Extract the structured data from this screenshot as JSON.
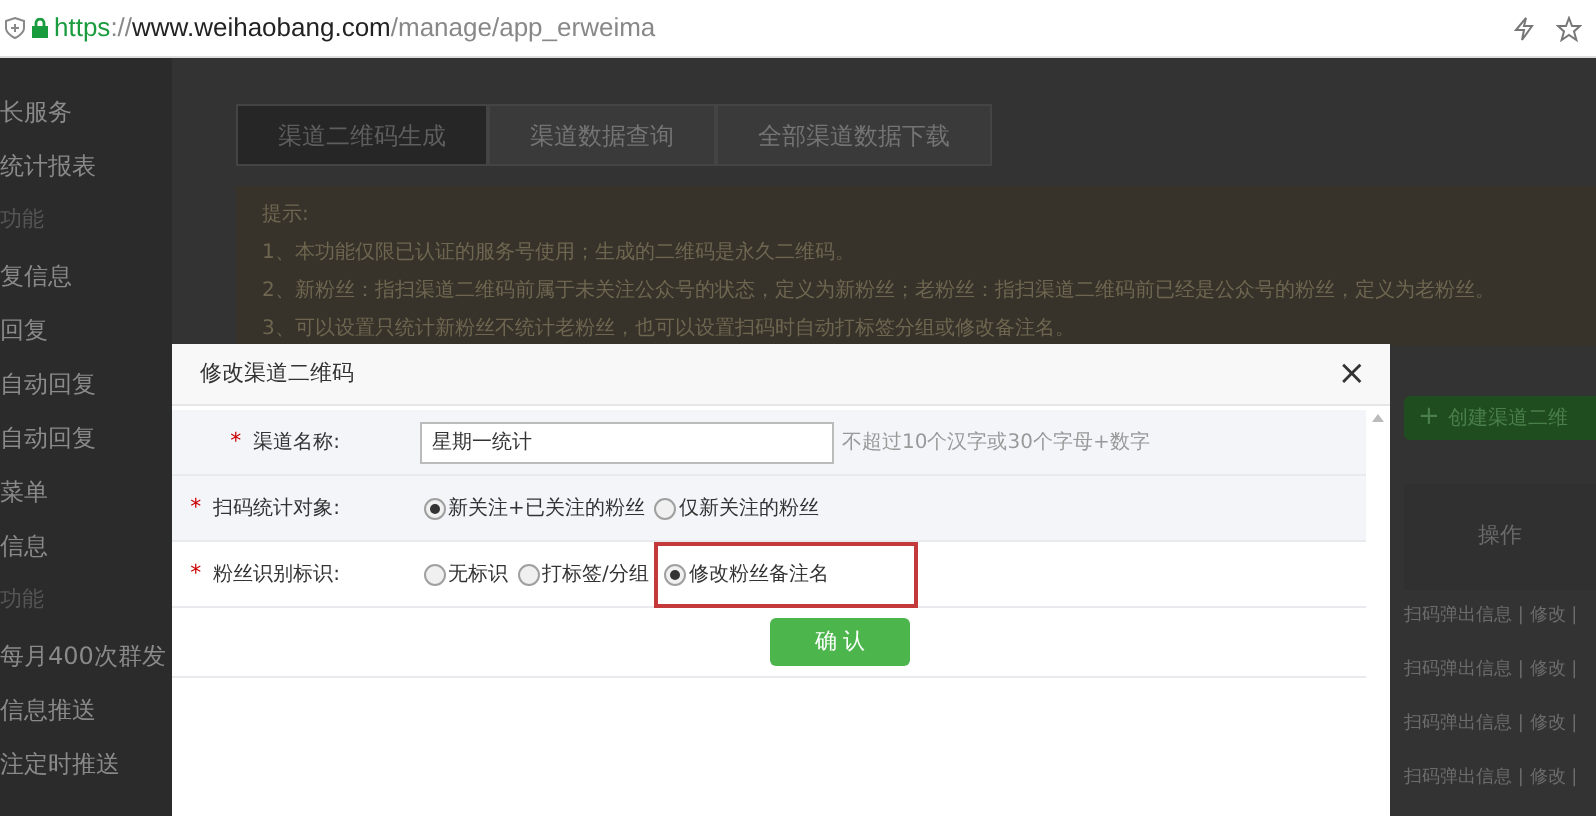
{
  "address_bar": {
    "scheme": "https",
    "separator": "://",
    "host": "www.weihaobang.com",
    "path": "/manage/app_erweima"
  },
  "sidebar": {
    "items": [
      {
        "label": "长服务",
        "kind": "item"
      },
      {
        "label": "统计报表",
        "kind": "item"
      },
      {
        "label": "功能",
        "kind": "section"
      },
      {
        "label": "复信息",
        "kind": "item"
      },
      {
        "label": "回复",
        "kind": "item"
      },
      {
        "label": "自动回复",
        "kind": "item"
      },
      {
        "label": "自动回复",
        "kind": "item"
      },
      {
        "label": "菜单",
        "kind": "item"
      },
      {
        "label": "信息",
        "kind": "item"
      },
      {
        "label": "功能",
        "kind": "section"
      },
      {
        "label": "每月400次群发",
        "kind": "item"
      },
      {
        "label": "信息推送",
        "kind": "item"
      },
      {
        "label": "注定时推送",
        "kind": "item"
      }
    ]
  },
  "tabs": [
    {
      "label": "渠道二维码生成",
      "selected": true
    },
    {
      "label": "渠道数据查询",
      "selected": false
    },
    {
      "label": "全部渠道数据下载",
      "selected": false
    }
  ],
  "tips": {
    "title": "提示:",
    "lines": [
      "1、本功能仅限已认证的服务号使用；生成的二维码是永久二维码。",
      "2、新粉丝：指扫渠道二维码前属于未关注公众号的状态，定义为新粉丝；老粉丝：指扫渠道二维码前已经是公众号的粉丝，定义为老粉丝。",
      "3、可以设置只统计新粉丝不统计老粉丝，也可以设置扫码时自动打标签分组或修改备注名。"
    ]
  },
  "create_button": {
    "icon": "+",
    "label": "创建渠道二维"
  },
  "table": {
    "columns": [
      "操作"
    ],
    "rows": [
      {
        "actions": "扫码弹出信息 | 修改 |"
      },
      {
        "actions": "扫码弹出信息 | 修改 |"
      },
      {
        "actions": "扫码弹出信息 | 修改 |"
      },
      {
        "actions": "扫码弹出信息 | 修改 |"
      }
    ]
  },
  "modal": {
    "title": "修改渠道二维码",
    "close": "×",
    "fields": [
      {
        "kind": "text",
        "mark": "*",
        "label": "渠道名称:",
        "value": "星期一统计",
        "hint": "不超过10个汉字或30个字母+数字"
      },
      {
        "kind": "radio",
        "mark": "*",
        "label": "扫码统计对象:",
        "options": [
          {
            "label": "新关注+已关注的粉丝",
            "selected": true,
            "highlighted": false
          },
          {
            "label": "仅新关注的粉丝",
            "selected": false,
            "highlighted": false
          }
        ]
      },
      {
        "kind": "radio",
        "mark": "*",
        "label": "粉丝识别标识:",
        "options": [
          {
            "label": "无标识",
            "selected": false,
            "highlighted": false
          },
          {
            "label": "打标签/分组",
            "selected": false,
            "highlighted": false
          },
          {
            "label": "修改粉丝备注名",
            "selected": true,
            "highlighted": true
          }
        ]
      }
    ],
    "confirm": "确 认"
  }
}
